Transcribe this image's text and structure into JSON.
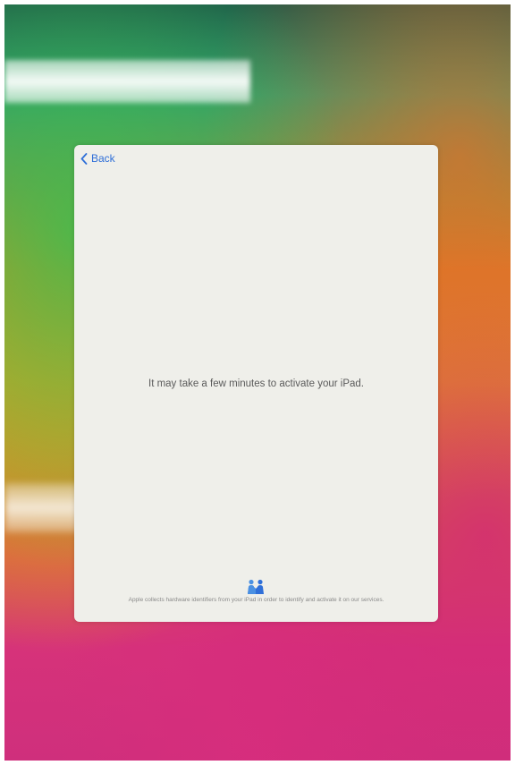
{
  "nav": {
    "back_label": "Back"
  },
  "main": {
    "message": "It may take a few minutes to activate your iPad."
  },
  "privacy": {
    "icon": "handshake-people-icon",
    "text": "Apple collects hardware identifiers from your iPad in order to identify and activate it on our services."
  },
  "colors": {
    "accent": "#2f6fd8",
    "sheet_background": "#efefea"
  }
}
